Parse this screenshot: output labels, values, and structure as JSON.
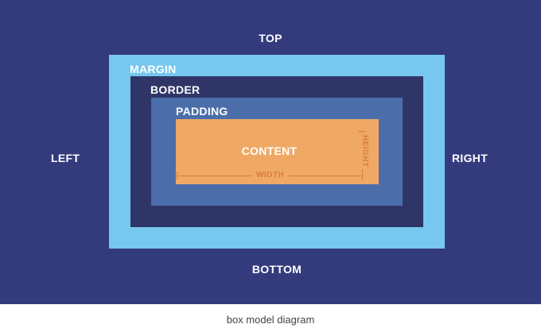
{
  "sides": {
    "top": "TOP",
    "bottom": "BOTTOM",
    "left": "LEFT",
    "right": "RIGHT"
  },
  "layers": {
    "margin": "MARGIN",
    "border": "BORDER",
    "padding": "PADDING",
    "content": "CONTENT"
  },
  "dimensions": {
    "width": "WIDTH",
    "height": "HEIGHT"
  },
  "colors": {
    "background": "#343b7d",
    "margin": "#77c7ee",
    "border": "#2f3667",
    "padding": "#4b6eaa",
    "content": "#efa965",
    "dimension_lines": "#d97e3b"
  },
  "caption": "box model diagram"
}
